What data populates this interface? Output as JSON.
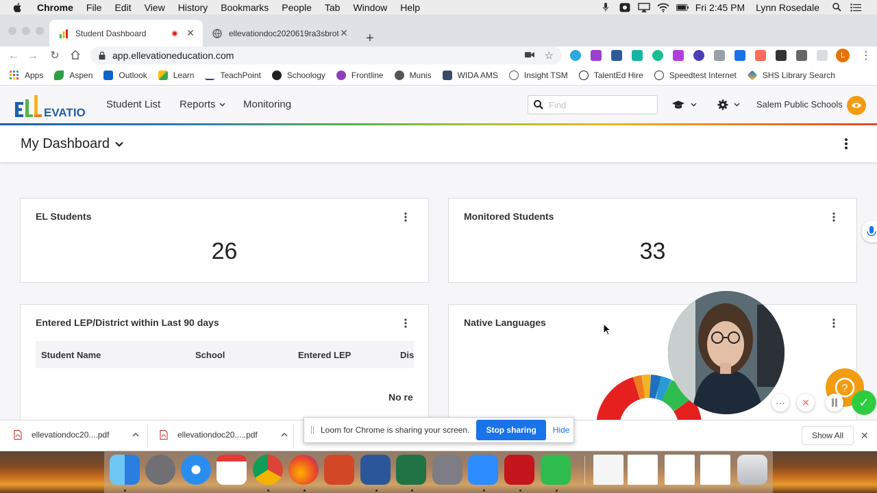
{
  "menubar": {
    "items": [
      "Chrome",
      "File",
      "Edit",
      "View",
      "History",
      "Bookmarks",
      "People",
      "Tab",
      "Window",
      "Help"
    ],
    "clock": "Fri 2:45 PM",
    "user": "Lynn Rosedale"
  },
  "browser": {
    "tabs": [
      {
        "title": "Student Dashboard"
      },
      {
        "title": "ellevationdoc2020619ra3sbrot"
      }
    ],
    "url": "app.ellevationeducation.com",
    "profile_initial": "L",
    "bookmarks": [
      "Apps",
      "Aspen",
      "Outlook",
      "Learn",
      "TeachPoint",
      "Schoology",
      "Frontline",
      "Munis",
      "WIDA AMS",
      "Insight TSM",
      "TalentEd Hire",
      "Speedtest Internet",
      "SHS Library Search"
    ]
  },
  "app": {
    "nav": {
      "student_list": "Student List",
      "reports": "Reports",
      "monitoring": "Monitoring"
    },
    "search_placeholder": "Find",
    "org": "Salem Public Schools",
    "dashboard_title": "My Dashboard"
  },
  "cards": {
    "el_students": {
      "title": "EL Students",
      "value": "26"
    },
    "monitored": {
      "title": "Monitored Students",
      "value": "33"
    },
    "entered_lep": {
      "title": "Entered LEP/District within Last 90 days",
      "columns": [
        "Student Name",
        "School",
        "Entered LEP",
        "Dis"
      ],
      "empty": "No re"
    },
    "native_languages": {
      "title": "Native Languages"
    }
  },
  "downloads": {
    "items": [
      "ellevationdoc20....pdf",
      "ellevationdoc20.....pdf"
    ],
    "show_all": "Show All"
  },
  "loom": {
    "message": "Loom for Chrome is sharing your screen.",
    "stop": "Stop sharing",
    "hide": "Hide"
  },
  "colors": {
    "accent_orange": "#f39c12",
    "chrome_blue": "#1a73e8",
    "donut": [
      "#e5201f",
      "#ee7d1f",
      "#f3b420",
      "#1f6fbf",
      "#2a9ad6",
      "#2ebc4f"
    ]
  }
}
